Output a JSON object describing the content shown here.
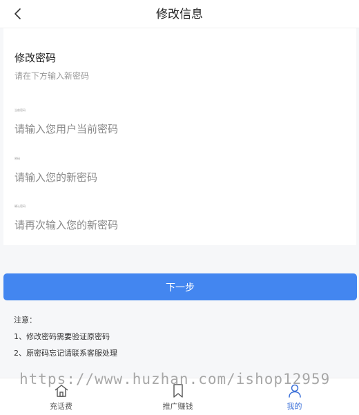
{
  "header": {
    "title": "修改信息"
  },
  "form": {
    "title": "修改密码",
    "subtitle": "请在下方输入新密码",
    "fields": [
      {
        "label": "当前密码",
        "placeholder": "请输入您用户当前密码",
        "value": ""
      },
      {
        "label": "密码",
        "placeholder": "请输入您的新密码",
        "value": ""
      },
      {
        "label": "确认密码",
        "placeholder": "请再次输入您的新密码",
        "value": ""
      }
    ]
  },
  "next_button": {
    "label": "下一步"
  },
  "notes": {
    "heading": "注意：",
    "items": [
      "1、修改密码需要验证原密码",
      "2、原密码忘记请联系客服处理"
    ]
  },
  "watermark": "https://www.huzhan.com/ishop12959",
  "tabbar": {
    "items": [
      {
        "label": "充话费",
        "icon": "home-icon"
      },
      {
        "label": "推广赚钱",
        "icon": "bookmark-icon"
      },
      {
        "label": "我的",
        "icon": "user-icon"
      }
    ],
    "active_index": 2,
    "active_color": "#3a6fd8"
  },
  "colors": {
    "primary_button": "#4386f0",
    "background": "#f6f7f9"
  }
}
